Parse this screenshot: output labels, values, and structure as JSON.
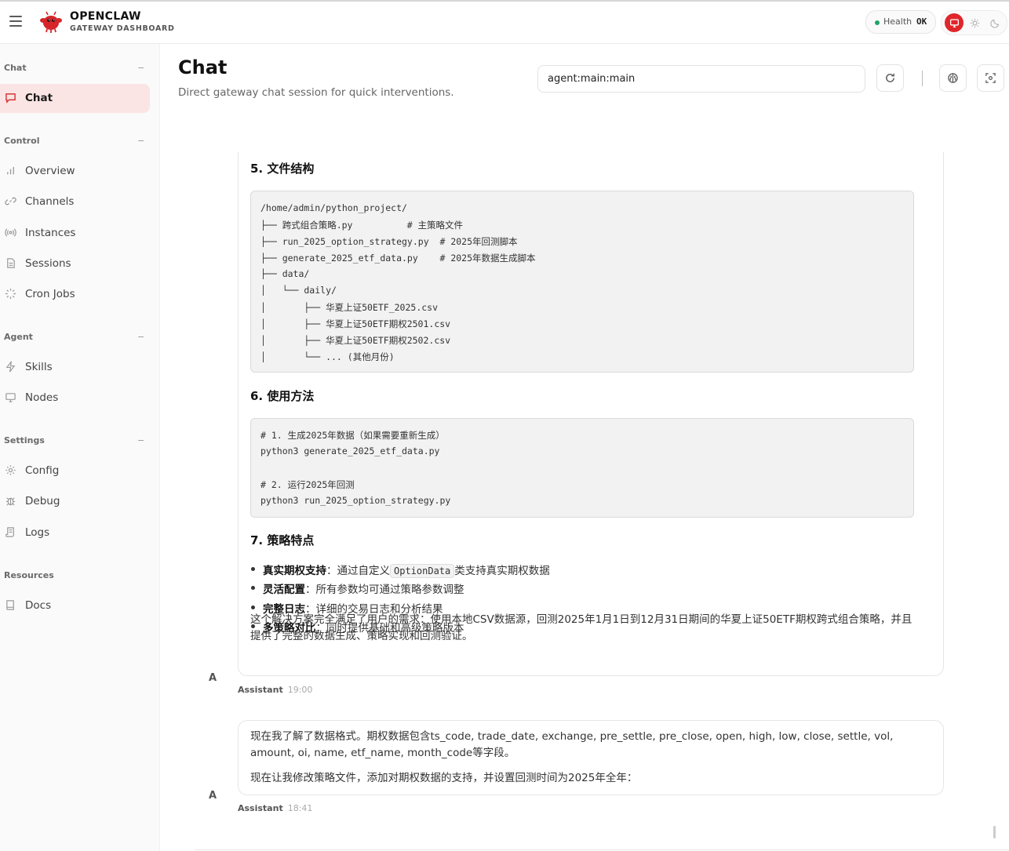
{
  "brand": {
    "name": "OPENCLAW",
    "subtitle": "GATEWAY DASHBOARD"
  },
  "health": {
    "label": "Health",
    "value": "OK",
    "status_color": "#21a366"
  },
  "theme": {
    "options": [
      "monitor-icon",
      "sun-icon",
      "moon-icon"
    ],
    "active": "monitor-icon",
    "accent": "#e0262b"
  },
  "sidebar": {
    "sections": [
      {
        "title": "Chat",
        "items": [
          {
            "label": "Chat",
            "icon": "chat-bubble-icon",
            "active": true
          }
        ]
      },
      {
        "title": "Control",
        "items": [
          {
            "label": "Overview",
            "icon": "bar-chart-icon"
          },
          {
            "label": "Channels",
            "icon": "link-icon"
          },
          {
            "label": "Instances",
            "icon": "radio-icon"
          },
          {
            "label": "Sessions",
            "icon": "document-icon"
          },
          {
            "label": "Cron Jobs",
            "icon": "loader-icon"
          }
        ]
      },
      {
        "title": "Agent",
        "items": [
          {
            "label": "Skills",
            "icon": "bolt-icon"
          },
          {
            "label": "Nodes",
            "icon": "monitor-icon"
          }
        ]
      },
      {
        "title": "Settings",
        "items": [
          {
            "label": "Config",
            "icon": "gear-icon"
          },
          {
            "label": "Debug",
            "icon": "bug-icon"
          },
          {
            "label": "Logs",
            "icon": "scroll-icon"
          }
        ]
      },
      {
        "title": "Resources",
        "items": [
          {
            "label": "Docs",
            "icon": "book-icon"
          }
        ]
      }
    ],
    "collapse_symbol": "−"
  },
  "header": {
    "title": "Chat",
    "subtitle": "Direct gateway chat session for quick interventions.",
    "session_value": "agent:main:main",
    "buttons": [
      "refresh-icon",
      "brain-icon",
      "focus-icon"
    ]
  },
  "messages": [
    {
      "sections": [
        {
          "heading": "5. 文件结构",
          "code": [
            "/home/admin/python_project/",
            "├── 跨式组合策略.py          # 主策略文件",
            "├── run_2025_option_strategy.py  # 2025年回测脚本",
            "├── generate_2025_etf_data.py    # 2025年数据生成脚本",
            "├── data/",
            "│   └── daily/",
            "│       ├── 华夏上证50ETF_2025.csv",
            "│       ├── 华夏上证50ETF期权2501.csv",
            "│       ├── 华夏上证50ETF期权2502.csv",
            "│       └── ... (其他月份)"
          ]
        },
        {
          "heading": "6. 使用方法",
          "code": [
            "# 1. 生成2025年数据（如果需要重新生成）",
            "python3 generate_2025_etf_data.py",
            "",
            "# 2. 运行2025年回测",
            "python3 run_2025_option_strategy.py"
          ]
        },
        {
          "heading": "7. 策略特点",
          "bullets": [
            {
              "key": "真实期权支持",
              "pre": "：通过自定义",
              "code": "OptionData",
              "post": "类支持真实期权数据"
            },
            {
              "key": "灵活配置",
              "pre": "：所有参数均可通过策略参数调整"
            },
            {
              "key": "完整日志",
              "pre": "：详细的交易日志和分析结果"
            },
            {
              "key": "多策略对比",
              "pre": "：同时提供基础和高级策略版本"
            }
          ],
          "paragraph": "这个解决方案完全满足了用户的需求：使用本地CSV数据源，回测2025年1月1日到12月31日期间的华夏上证50ETF期权跨式组合策略，并且提供了完整的数据生成、策略实现和回测验证。"
        }
      ],
      "avatar": "A",
      "sender": "Assistant",
      "time": "19:00"
    },
    {
      "paragraphs": [
        "现在我了解了数据格式。期权数据包含ts_code, trade_date, exchange, pre_settle, pre_close, open, high, low, close, settle, vol, amount, oi, name, etf_name, month_code等字段。",
        "现在让我修改策略文件，添加对期权数据的支持，并设置回测时间为2025年全年："
      ],
      "avatar": "A",
      "sender": "Assistant",
      "time": "18:41"
    }
  ]
}
